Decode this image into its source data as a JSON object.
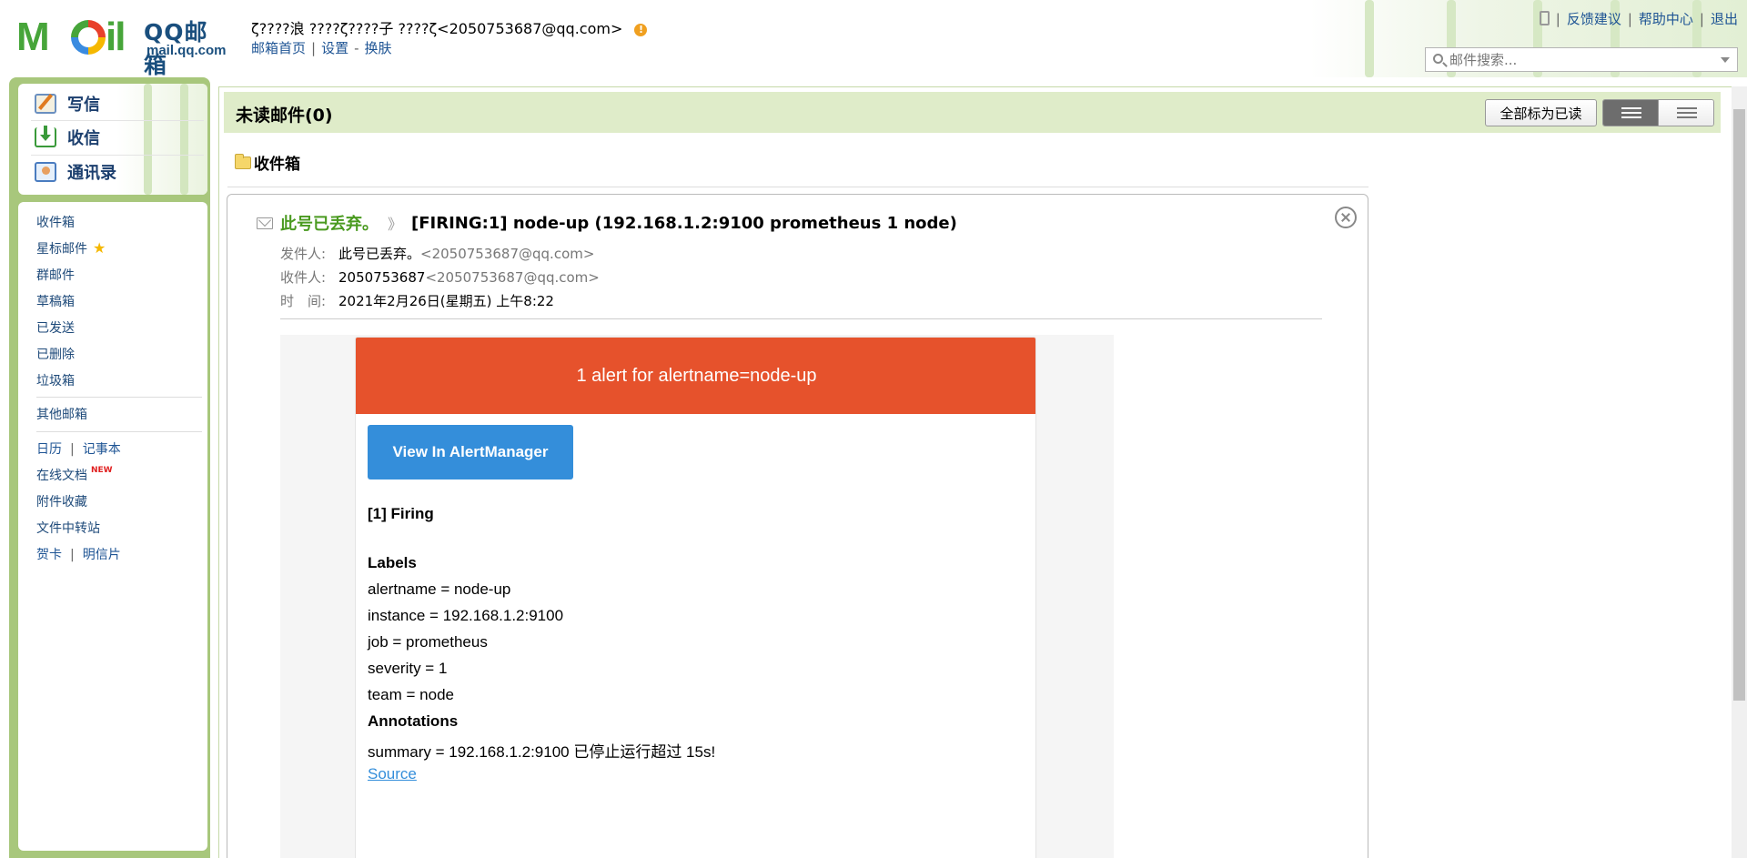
{
  "header": {
    "user_name": "ζ????浪 ????ζ????子 ????ζ",
    "user_email": "<2050753687@qq.com>",
    "warning_mark": "!",
    "links": [
      "邮箱首页",
      "设置",
      "换肤"
    ],
    "top_links": [
      "反馈建议",
      "帮助中心",
      "退出"
    ],
    "search_placeholder": "邮件搜索...",
    "logo_qq": "QQ邮箱",
    "logo_url": "mail.qq.com"
  },
  "quick_actions": {
    "write": "写信",
    "receive": "收信",
    "contacts": "通讯录"
  },
  "folders": {
    "inbox": "收件箱",
    "starred": "星标邮件",
    "group": "群邮件",
    "drafts": "草稿箱",
    "sent": "已发送",
    "deleted": "已删除",
    "spam": "垃圾箱",
    "other": "其他邮箱",
    "calendar": "日历",
    "notes": "记事本",
    "docs": "在线文档",
    "docs_badge": "NEW",
    "attachments": "附件收藏",
    "transfer": "文件中转站",
    "card": "贺卡",
    "postcard": "明信片"
  },
  "toolbar": {
    "title": "未读邮件(0)",
    "mark_all_read": "全部标为已读"
  },
  "breadcrumb": {
    "folder": "收件箱"
  },
  "mail": {
    "sender_name": "此号已丢弃。",
    "subject_sep": "》",
    "subject": "[FIRING:1] node-up (192.168.1.2:9100 prometheus 1 node)",
    "from_label": "发件人:",
    "from_name": "此号已丢弃。",
    "from_email": "<2050753687@qq.com>",
    "to_label": "收件人:",
    "to_name": "2050753687",
    "to_email": "<2050753687@qq.com>",
    "time_label": "时　间:",
    "time_value": "2021年2月26日(星期五) 上午8:22"
  },
  "alert": {
    "header": "1 alert for alertname=node-up",
    "button": "View In AlertManager",
    "firing": "[1] Firing",
    "labels_title": "Labels",
    "labels": [
      "alertname = node-up",
      "instance = 192.168.1.2:9100",
      "job = prometheus",
      "severity = 1",
      "team = node"
    ],
    "annotations_title": "Annotations",
    "summary": "summary = 192.168.1.2:9100 已停止运行超过 15s!",
    "source": "Source"
  },
  "colors": {
    "alert_red": "#e6522c",
    "button_blue": "#348eda",
    "theme_green": "#a8c77c",
    "toolbar_green": "#dfecc9",
    "sender_green": "#4a9a20"
  }
}
